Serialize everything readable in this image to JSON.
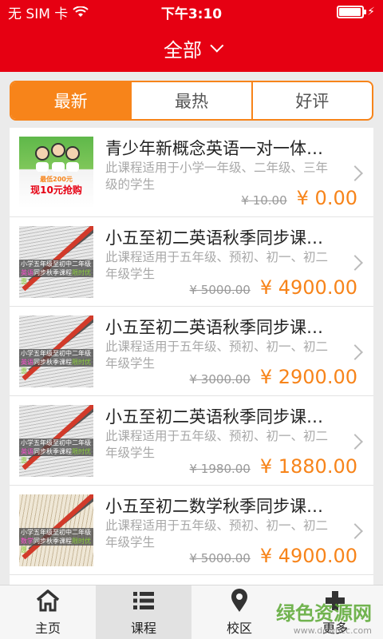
{
  "status_bar": {
    "carrier": "无 SIM 卡",
    "time": "下午3:10",
    "battery_level": 0.95
  },
  "nav": {
    "title": "全部"
  },
  "tabs": [
    {
      "label": "最新",
      "active": true
    },
    {
      "label": "最热",
      "active": false
    },
    {
      "label": "好评",
      "active": false
    }
  ],
  "courses": [
    {
      "title": "青少年新概念英语一对一体…",
      "desc": "此课程适用于小学一年级、二年级、三年级的学生",
      "old_price": "¥ 10.00",
      "price": "¥ 0.00",
      "thumb_caption_1": "最低200元",
      "thumb_caption_2": "现10元抢购"
    },
    {
      "title": "小五至初二英语秋季同步课…",
      "desc": "此课程适用于五年级、预初、初一、初二年级学生",
      "old_price": "¥ 5000.00",
      "price": "¥ 4900.00",
      "thumb_line_1": "小学五年级至初中二年级",
      "thumb_line_2a": "英语",
      "thumb_line_2b": "同步秋季课程",
      "thumb_line_2c": "限时优惠"
    },
    {
      "title": "小五至初二英语秋季同步课…",
      "desc": "此课程适用于五年级、预初、初一、初二年级学生",
      "old_price": "¥ 3000.00",
      "price": "¥ 2900.00",
      "thumb_line_1": "小学五年级至初中二年级",
      "thumb_line_2a": "英语",
      "thumb_line_2b": "同步秋季课程",
      "thumb_line_2c": "限时优惠"
    },
    {
      "title": "小五至初二英语秋季同步课…",
      "desc": "此课程适用于五年级、预初、初一、初二年级学生",
      "old_price": "¥ 1980.00",
      "price": "¥ 1880.00",
      "thumb_line_1": "小学五年级至初中二年级",
      "thumb_line_2a": "英语",
      "thumb_line_2b": "同步秋季课程",
      "thumb_line_2c": "限时优惠"
    },
    {
      "title": "小五至初二数学秋季同步课…",
      "desc": "此课程适用于五年级、预初、初一、初二年级学生",
      "old_price": "¥ 5000.00",
      "price": "¥ 4900.00",
      "thumb_line_1": "小学五年级至初中二年级",
      "thumb_line_2a": "数学",
      "thumb_line_2b": "同步秋季课程",
      "thumb_line_2c": "限时优惠"
    }
  ],
  "tabbar": [
    {
      "label": "主页",
      "icon": "home-icon",
      "active": false
    },
    {
      "label": "课程",
      "icon": "list-icon",
      "active": true
    },
    {
      "label": "校区",
      "icon": "location-pin-icon",
      "active": false
    },
    {
      "label": "更多",
      "icon": "more-icon",
      "active": false
    }
  ],
  "watermark": {
    "text": "绿色资源网",
    "sub": "www.downcc.com"
  },
  "colors": {
    "brand_red": "#e60012",
    "accent_orange": "#f7841a"
  }
}
